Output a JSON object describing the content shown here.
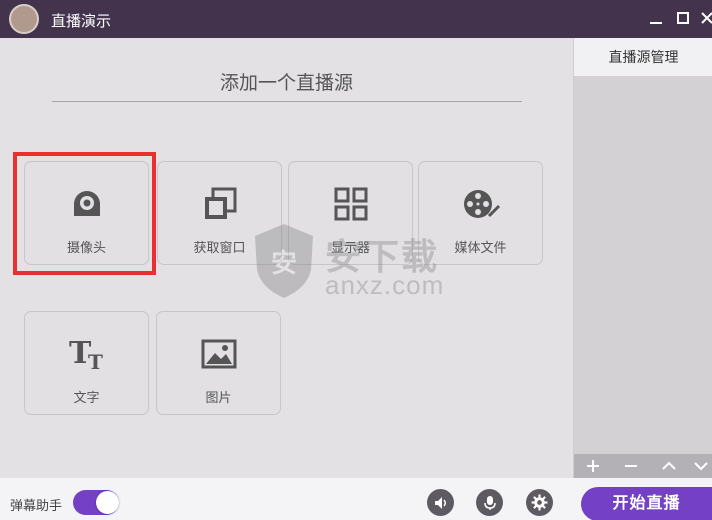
{
  "window": {
    "title": "直播演示"
  },
  "main": {
    "heading": "添加一个直播源",
    "tiles": [
      {
        "label": "摄像头",
        "icon": "webcam-icon"
      },
      {
        "label": "获取窗口",
        "icon": "capture-window-icon"
      },
      {
        "label": "显示器",
        "icon": "display-grid-icon"
      },
      {
        "label": "媒体文件",
        "icon": "media-reel-icon"
      },
      {
        "label": "文字",
        "icon": "text-icon"
      },
      {
        "label": "图片",
        "icon": "image-icon"
      }
    ],
    "selected_tile": "摄像头",
    "highlight_color": "#e8302f"
  },
  "watermark": {
    "text": "安下载",
    "sub": "anxz.com"
  },
  "source_panel": {
    "title": "直播源管理",
    "tools": [
      "plus-icon",
      "minus-icon",
      "chevron-up-icon",
      "chevron-down-icon"
    ]
  },
  "bottom": {
    "bullet_label": "弹幕助手",
    "bullet_enabled": true,
    "buttons": [
      "volume-icon",
      "microphone-icon",
      "settings-icon"
    ],
    "start_label": "开始直播"
  },
  "colors": {
    "titlebar": "#44334d",
    "accent": "#7340c6",
    "background": "#e3e1e4"
  }
}
